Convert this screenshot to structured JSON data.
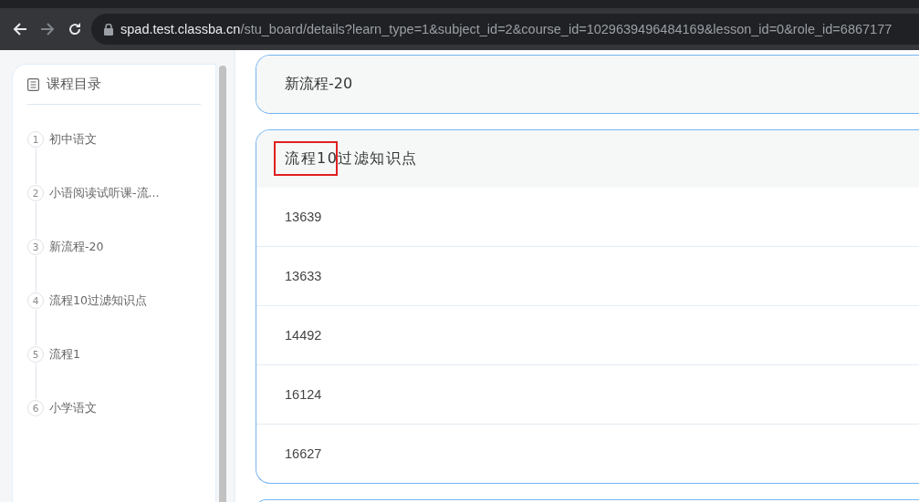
{
  "browser": {
    "url_host": "spad.test.classba.cn",
    "url_path": "/stu_board/details?learn_type=1&subject_id=2&course_id=1029639496484169&lesson_id=0&role_id=6867177"
  },
  "sidebar": {
    "title": "课程目录",
    "items": [
      {
        "number": "1",
        "label": "初中语文"
      },
      {
        "number": "2",
        "label": "小语阅读试听课-流..."
      },
      {
        "number": "3",
        "label": "新流程-20"
      },
      {
        "number": "4",
        "label": "流程10过滤知识点"
      },
      {
        "number": "5",
        "label": "流程1"
      },
      {
        "number": "6",
        "label": "小学语文"
      }
    ]
  },
  "sections": [
    {
      "title": "新流程-20",
      "expanded": false
    },
    {
      "title": "流程10过滤知识点",
      "expanded": true,
      "rows": [
        "13639",
        "13633",
        "14492",
        "16124",
        "16627"
      ]
    }
  ]
}
